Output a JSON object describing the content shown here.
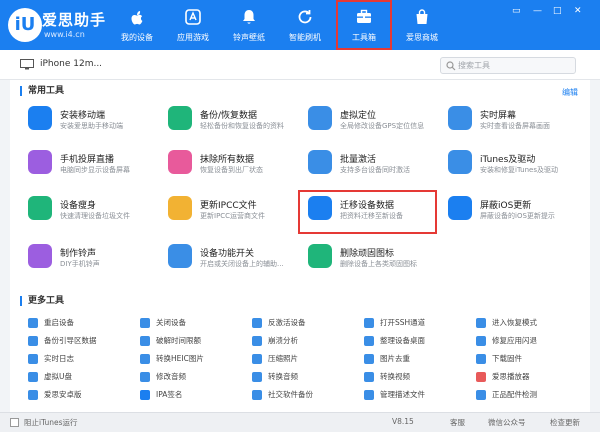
{
  "app": {
    "brand": "爱思助手",
    "url": "www.i4.cn",
    "logo_letter": "iU"
  },
  "nav": [
    {
      "label": "我的设备",
      "icon": "apple-icon"
    },
    {
      "label": "应用游戏",
      "icon": "app-store-icon"
    },
    {
      "label": "铃声壁纸",
      "icon": "bell-icon"
    },
    {
      "label": "智能刷机",
      "icon": "refresh-icon"
    },
    {
      "label": "工具箱",
      "icon": "toolbox-icon"
    },
    {
      "label": "爱思商城",
      "icon": "shop-bag-icon"
    }
  ],
  "window_controls": [
    "▭",
    "—",
    "□",
    "✕"
  ],
  "toolbar": {
    "device_name": "iPhone 12m...",
    "search_placeholder": "搜索工具"
  },
  "sections": {
    "common_title": "常用工具",
    "edit_label": "编辑",
    "more_title": "更多工具"
  },
  "tools": [
    {
      "title": "安装移动端",
      "desc": "安装爱思助手移动端",
      "icon": "i4-app-icon",
      "color": "#1b7ff0"
    },
    {
      "title": "备份/恢复数据",
      "desc": "轻松备份和恢复设备的资料",
      "icon": "layers-icon",
      "color": "#1fb57a"
    },
    {
      "title": "虚拟定位",
      "desc": "全局修改设备GPS定位信息",
      "icon": "map-pin-icon",
      "color": "#3a8ee6"
    },
    {
      "title": "实时屏幕",
      "desc": "实时查看设备屏幕画面",
      "icon": "screen-icon",
      "color": "#3a8ee6"
    },
    {
      "title": "手机投屏直播",
      "desc": "电脑同步显示设备屏幕",
      "icon": "cast-icon",
      "color": "#9c5ee0"
    },
    {
      "title": "抹除所有数据",
      "desc": "恢复设备到出厂状态",
      "icon": "eraser-icon",
      "color": "#e85a9b"
    },
    {
      "title": "批量激活",
      "desc": "支持多台设备同时激活",
      "icon": "inbox-icon",
      "color": "#3a8ee6"
    },
    {
      "title": "iTunes及驱动",
      "desc": "安装和修复iTunes及驱动",
      "icon": "music-note-icon",
      "color": "#3a8ee6"
    },
    {
      "title": "设备瘦身",
      "desc": "快速清理设备垃圾文件",
      "icon": "broom-icon",
      "color": "#1fb57a"
    },
    {
      "title": "更新IPCC文件",
      "desc": "更新IPCC运营商文件",
      "icon": "folder-icon",
      "color": "#f2b233"
    },
    {
      "title": "迁移设备数据",
      "desc": "把资料迁移至新设备",
      "icon": "transfer-icon",
      "color": "#1b7ff0"
    },
    {
      "title": "屏蔽iOS更新",
      "desc": "屏蔽设备的iOS更新提示",
      "icon": "block-update-icon",
      "color": "#1b7ff0"
    },
    {
      "title": "制作铃声",
      "desc": "DIY手机铃声",
      "icon": "music-disc-icon",
      "color": "#9c5ee0"
    },
    {
      "title": "设备功能开关",
      "desc": "开启或关闭设备上的辅助...",
      "icon": "sliders-icon",
      "color": "#3a8ee6"
    },
    {
      "title": "删除顽固图标",
      "desc": "删除设备上各类顽固图标",
      "icon": "trash-icon",
      "color": "#1fb57a"
    }
  ],
  "more_tools": [
    {
      "label": "重启设备",
      "icon": "restart-icon",
      "color": "#3a8ee6"
    },
    {
      "label": "关闭设备",
      "icon": "power-icon",
      "color": "#3a8ee6"
    },
    {
      "label": "反激活设备",
      "icon": "deactivate-icon",
      "color": "#3a8ee6"
    },
    {
      "label": "打开SSH通道",
      "icon": "ssh-icon",
      "color": "#3a8ee6"
    },
    {
      "label": "进入恢复模式",
      "icon": "recovery-icon",
      "color": "#3a8ee6"
    },
    {
      "label": "备份引导区数据",
      "icon": "backup-boot-icon",
      "color": "#3a8ee6"
    },
    {
      "label": "破解时间限额",
      "icon": "timer-icon",
      "color": "#3a8ee6"
    },
    {
      "label": "崩溃分析",
      "icon": "crash-chart-icon",
      "color": "#3a8ee6"
    },
    {
      "label": "整理设备桌面",
      "icon": "grid-icon",
      "color": "#3a8ee6"
    },
    {
      "label": "修复应用闪退",
      "icon": "fix-app-icon",
      "color": "#3a8ee6"
    },
    {
      "label": "实时日志",
      "icon": "log-icon",
      "color": "#3a8ee6"
    },
    {
      "label": "转换HEIC图片",
      "icon": "image-convert-icon",
      "color": "#3a8ee6"
    },
    {
      "label": "压缩照片",
      "icon": "compress-icon",
      "color": "#3a8ee6"
    },
    {
      "label": "图片去重",
      "icon": "dedupe-icon",
      "color": "#3a8ee6"
    },
    {
      "label": "下载固件",
      "icon": "download-icon",
      "color": "#3a8ee6"
    },
    {
      "label": "虚拟U盘",
      "icon": "usb-icon",
      "color": "#3a8ee6"
    },
    {
      "label": "修改音频",
      "icon": "audio-icon",
      "color": "#3a8ee6"
    },
    {
      "label": "转换音频",
      "icon": "audio-convert-icon",
      "color": "#3a8ee6"
    },
    {
      "label": "转换视频",
      "icon": "video-convert-icon",
      "color": "#3a8ee6"
    },
    {
      "label": "爱思播放器",
      "icon": "player-icon",
      "color": "#e85a5a"
    },
    {
      "label": "爱思安卓版",
      "icon": "android-icon",
      "color": "#3a8ee6"
    },
    {
      "label": "IPA签名",
      "icon": "ipa-icon",
      "color": "#1b7ff0"
    },
    {
      "label": "社交软件备份",
      "icon": "chat-backup-icon",
      "color": "#3a8ee6"
    },
    {
      "label": "管理描述文件",
      "icon": "profile-icon",
      "color": "#3a8ee6"
    },
    {
      "label": "正品配件检测",
      "icon": "accessory-check-icon",
      "color": "#3a8ee6"
    }
  ],
  "bottom": {
    "itunes_label": "阻止iTunes运行",
    "version": "V8.15",
    "feedback": "客服",
    "wechat": "微信公众号",
    "check_update": "检查更新"
  }
}
